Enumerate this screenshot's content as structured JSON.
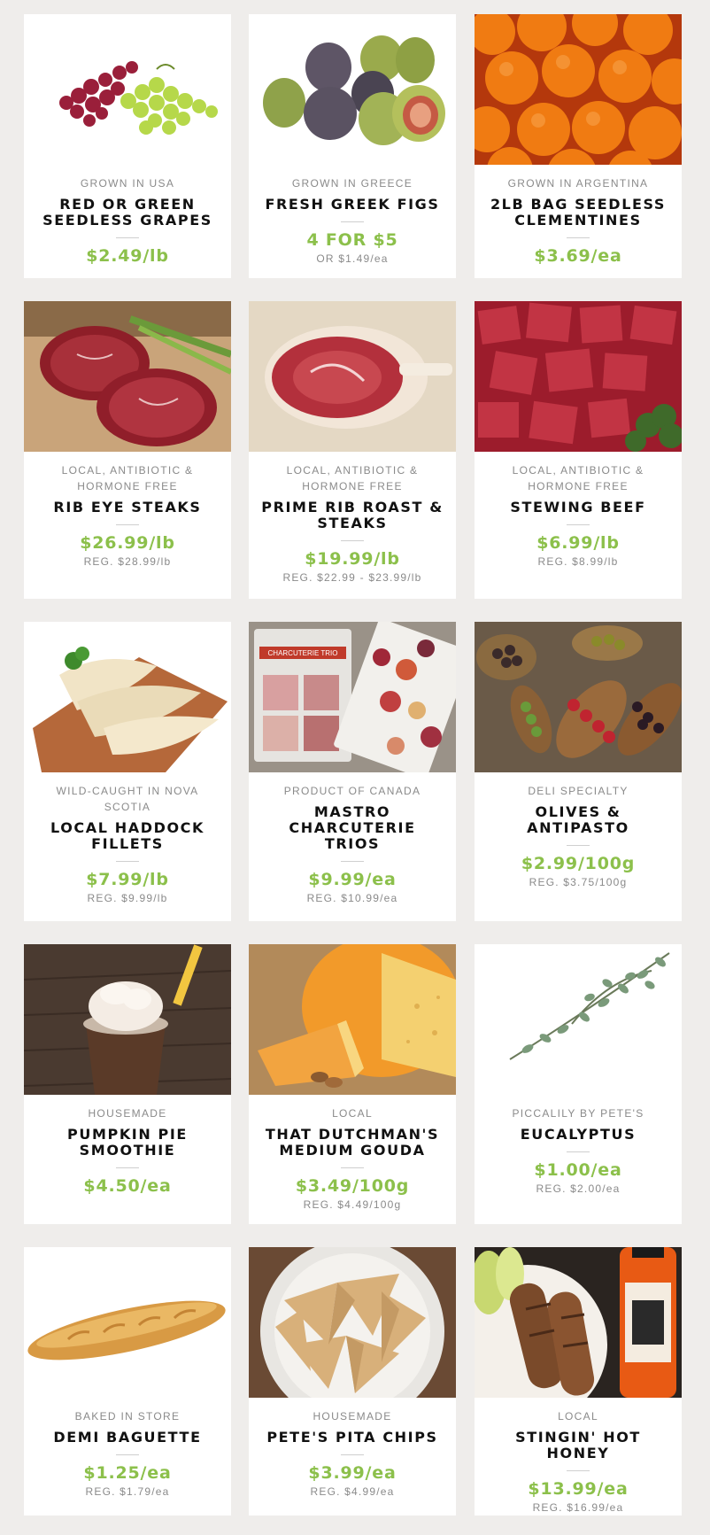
{
  "products": [
    {
      "origin": "GROWN IN USA",
      "name": "RED OR GREEN SEEDLESS GRAPES",
      "price": "$2.49/lb",
      "reg": "",
      "image": "grapes-image"
    },
    {
      "origin": "GROWN IN GREECE",
      "name": "FRESH GREEK FIGS",
      "price": "4 FOR $5",
      "reg": "OR $1.49/ea",
      "image": "figs-image"
    },
    {
      "origin": "GROWN IN ARGENTINA",
      "name": "2LB BAG SEEDLESS CLEMENTINES",
      "price": "$3.69/ea",
      "reg": "",
      "image": "clementines-image"
    },
    {
      "origin": "LOCAL, ANTIBIOTIC & HORMONE FREE",
      "name": "RIB EYE STEAKS",
      "price": "$26.99/lb",
      "reg": "REG. $28.99/lb",
      "image": "ribeye-image"
    },
    {
      "origin": "LOCAL, ANTIBIOTIC & HORMONE FREE",
      "name": "PRIME RIB ROAST & STEAKS",
      "price": "$19.99/lb",
      "reg": "REG. $22.99 - $23.99/lb",
      "image": "prime-rib-image"
    },
    {
      "origin": "LOCAL, ANTIBIOTIC & HORMONE FREE",
      "name": "STEWING BEEF",
      "price": "$6.99/lb",
      "reg": "REG. $8.99/lb",
      "image": "stewing-beef-image"
    },
    {
      "origin": "WILD-CAUGHT IN NOVA SCOTIA",
      "name": "LOCAL HADDOCK FILLETS",
      "price": "$7.99/lb",
      "reg": "REG. $9.99/lb",
      "image": "haddock-image"
    },
    {
      "origin": "PRODUCT OF CANADA",
      "name": "MASTRO CHARCUTERIE TRIOS",
      "price": "$9.99/ea",
      "reg": "REG. $10.99/ea",
      "image": "charcuterie-image",
      "image_text": "CHARCUTERIE TRIO"
    },
    {
      "origin": "DELI SPECIALTY",
      "name": "OLIVES & ANTIPASTO",
      "price": "$2.99/100g",
      "reg": "REG. $3.75/100g",
      "image": "olives-image"
    },
    {
      "origin": "HOUSEMADE",
      "name": "PUMPKIN PIE SMOOTHIE",
      "price": "$4.50/ea",
      "reg": "",
      "image": "smoothie-image"
    },
    {
      "origin": "LOCAL",
      "name": "THAT DUTCHMAN'S MEDIUM GOUDA",
      "price": "$3.49/100g",
      "reg": "REG. $4.49/100g",
      "image": "gouda-image"
    },
    {
      "origin": "PICCALILY BY PETE'S",
      "name": "EUCALYPTUS",
      "price": "$1.00/ea",
      "reg": "REG. $2.00/ea",
      "image": "eucalyptus-image"
    },
    {
      "origin": "BAKED IN STORE",
      "name": "DEMI BAGUETTE",
      "price": "$1.25/ea",
      "reg": "REG. $1.79/ea",
      "image": "baguette-image"
    },
    {
      "origin": "HOUSEMADE",
      "name": "PETE'S PITA CHIPS",
      "price": "$3.99/ea",
      "reg": "REG. $4.99/ea",
      "image": "pita-chips-image"
    },
    {
      "origin": "LOCAL",
      "name": "STINGIN' HOT HONEY",
      "price": "$13.99/ea",
      "reg": "REG. $16.99/ea",
      "image": "hot-honey-image"
    }
  ],
  "colors": {
    "background": "#efedeb",
    "card": "#ffffff",
    "price": "#8cc04b",
    "muted": "#8a8a8a",
    "title": "#111111"
  }
}
